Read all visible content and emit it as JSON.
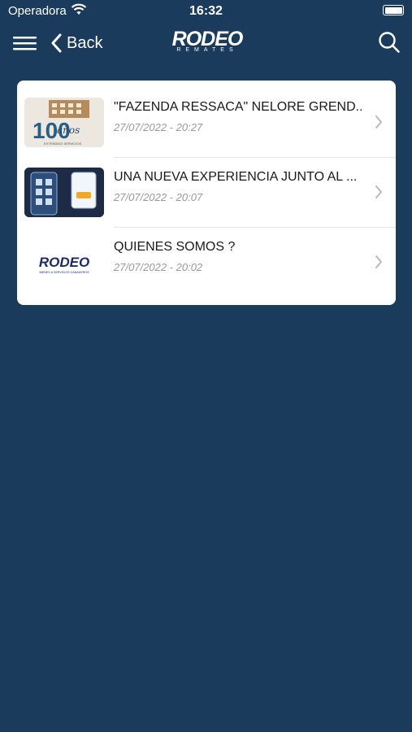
{
  "status": {
    "carrier": "Operadora",
    "time": "16:32"
  },
  "nav": {
    "back_label": "Back",
    "logo_text": "RODEO",
    "logo_subtext": "REMATES"
  },
  "thumbs": {
    "t1_number": "100",
    "t1_word": "años",
    "t1_caption": "EXTENDIDO SERVICIOS",
    "t3_logo": "RODEO",
    "t3_caption": "BIENES & SERVICIOS GANADEROS"
  },
  "news": [
    {
      "title": "\"FAZENDA RESSACA\" NELORE GREND...",
      "date": "27/07/2022 - 20:27"
    },
    {
      "title": "UNA NUEVA EXPERIENCIA JUNTO AL ...",
      "date": "27/07/2022 - 20:07"
    },
    {
      "title": "QUIENES SOMOS ?",
      "date": "27/07/2022 - 20:02"
    }
  ],
  "colors": {
    "background": "#1b3b5c",
    "card": "#ffffff",
    "date": "#9a9a9a"
  }
}
